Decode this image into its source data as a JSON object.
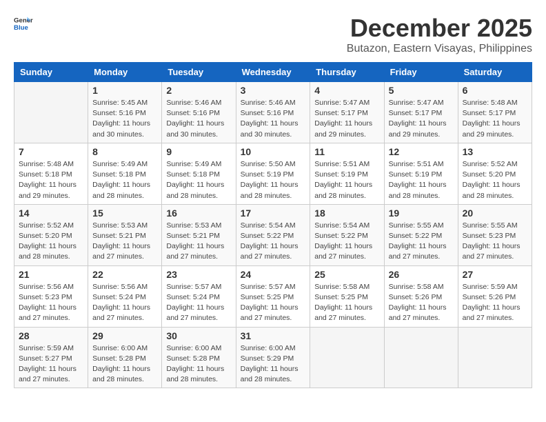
{
  "logo": {
    "general": "General",
    "blue": "Blue"
  },
  "title": {
    "month": "December 2025",
    "location": "Butazon, Eastern Visayas, Philippines"
  },
  "headers": [
    "Sunday",
    "Monday",
    "Tuesday",
    "Wednesday",
    "Thursday",
    "Friday",
    "Saturday"
  ],
  "weeks": [
    [
      {
        "day": "",
        "info": ""
      },
      {
        "day": "1",
        "info": "Sunrise: 5:45 AM\nSunset: 5:16 PM\nDaylight: 11 hours\nand 30 minutes."
      },
      {
        "day": "2",
        "info": "Sunrise: 5:46 AM\nSunset: 5:16 PM\nDaylight: 11 hours\nand 30 minutes."
      },
      {
        "day": "3",
        "info": "Sunrise: 5:46 AM\nSunset: 5:16 PM\nDaylight: 11 hours\nand 30 minutes."
      },
      {
        "day": "4",
        "info": "Sunrise: 5:47 AM\nSunset: 5:17 PM\nDaylight: 11 hours\nand 29 minutes."
      },
      {
        "day": "5",
        "info": "Sunrise: 5:47 AM\nSunset: 5:17 PM\nDaylight: 11 hours\nand 29 minutes."
      },
      {
        "day": "6",
        "info": "Sunrise: 5:48 AM\nSunset: 5:17 PM\nDaylight: 11 hours\nand 29 minutes."
      }
    ],
    [
      {
        "day": "7",
        "info": "Sunrise: 5:48 AM\nSunset: 5:18 PM\nDaylight: 11 hours\nand 29 minutes."
      },
      {
        "day": "8",
        "info": "Sunrise: 5:49 AM\nSunset: 5:18 PM\nDaylight: 11 hours\nand 28 minutes."
      },
      {
        "day": "9",
        "info": "Sunrise: 5:49 AM\nSunset: 5:18 PM\nDaylight: 11 hours\nand 28 minutes."
      },
      {
        "day": "10",
        "info": "Sunrise: 5:50 AM\nSunset: 5:19 PM\nDaylight: 11 hours\nand 28 minutes."
      },
      {
        "day": "11",
        "info": "Sunrise: 5:51 AM\nSunset: 5:19 PM\nDaylight: 11 hours\nand 28 minutes."
      },
      {
        "day": "12",
        "info": "Sunrise: 5:51 AM\nSunset: 5:19 PM\nDaylight: 11 hours\nand 28 minutes."
      },
      {
        "day": "13",
        "info": "Sunrise: 5:52 AM\nSunset: 5:20 PM\nDaylight: 11 hours\nand 28 minutes."
      }
    ],
    [
      {
        "day": "14",
        "info": "Sunrise: 5:52 AM\nSunset: 5:20 PM\nDaylight: 11 hours\nand 28 minutes."
      },
      {
        "day": "15",
        "info": "Sunrise: 5:53 AM\nSunset: 5:21 PM\nDaylight: 11 hours\nand 27 minutes."
      },
      {
        "day": "16",
        "info": "Sunrise: 5:53 AM\nSunset: 5:21 PM\nDaylight: 11 hours\nand 27 minutes."
      },
      {
        "day": "17",
        "info": "Sunrise: 5:54 AM\nSunset: 5:22 PM\nDaylight: 11 hours\nand 27 minutes."
      },
      {
        "day": "18",
        "info": "Sunrise: 5:54 AM\nSunset: 5:22 PM\nDaylight: 11 hours\nand 27 minutes."
      },
      {
        "day": "19",
        "info": "Sunrise: 5:55 AM\nSunset: 5:22 PM\nDaylight: 11 hours\nand 27 minutes."
      },
      {
        "day": "20",
        "info": "Sunrise: 5:55 AM\nSunset: 5:23 PM\nDaylight: 11 hours\nand 27 minutes."
      }
    ],
    [
      {
        "day": "21",
        "info": "Sunrise: 5:56 AM\nSunset: 5:23 PM\nDaylight: 11 hours\nand 27 minutes."
      },
      {
        "day": "22",
        "info": "Sunrise: 5:56 AM\nSunset: 5:24 PM\nDaylight: 11 hours\nand 27 minutes."
      },
      {
        "day": "23",
        "info": "Sunrise: 5:57 AM\nSunset: 5:24 PM\nDaylight: 11 hours\nand 27 minutes."
      },
      {
        "day": "24",
        "info": "Sunrise: 5:57 AM\nSunset: 5:25 PM\nDaylight: 11 hours\nand 27 minutes."
      },
      {
        "day": "25",
        "info": "Sunrise: 5:58 AM\nSunset: 5:25 PM\nDaylight: 11 hours\nand 27 minutes."
      },
      {
        "day": "26",
        "info": "Sunrise: 5:58 AM\nSunset: 5:26 PM\nDaylight: 11 hours\nand 27 minutes."
      },
      {
        "day": "27",
        "info": "Sunrise: 5:59 AM\nSunset: 5:26 PM\nDaylight: 11 hours\nand 27 minutes."
      }
    ],
    [
      {
        "day": "28",
        "info": "Sunrise: 5:59 AM\nSunset: 5:27 PM\nDaylight: 11 hours\nand 27 minutes."
      },
      {
        "day": "29",
        "info": "Sunrise: 6:00 AM\nSunset: 5:28 PM\nDaylight: 11 hours\nand 28 minutes."
      },
      {
        "day": "30",
        "info": "Sunrise: 6:00 AM\nSunset: 5:28 PM\nDaylight: 11 hours\nand 28 minutes."
      },
      {
        "day": "31",
        "info": "Sunrise: 6:00 AM\nSunset: 5:29 PM\nDaylight: 11 hours\nand 28 minutes."
      },
      {
        "day": "",
        "info": ""
      },
      {
        "day": "",
        "info": ""
      },
      {
        "day": "",
        "info": ""
      }
    ]
  ]
}
